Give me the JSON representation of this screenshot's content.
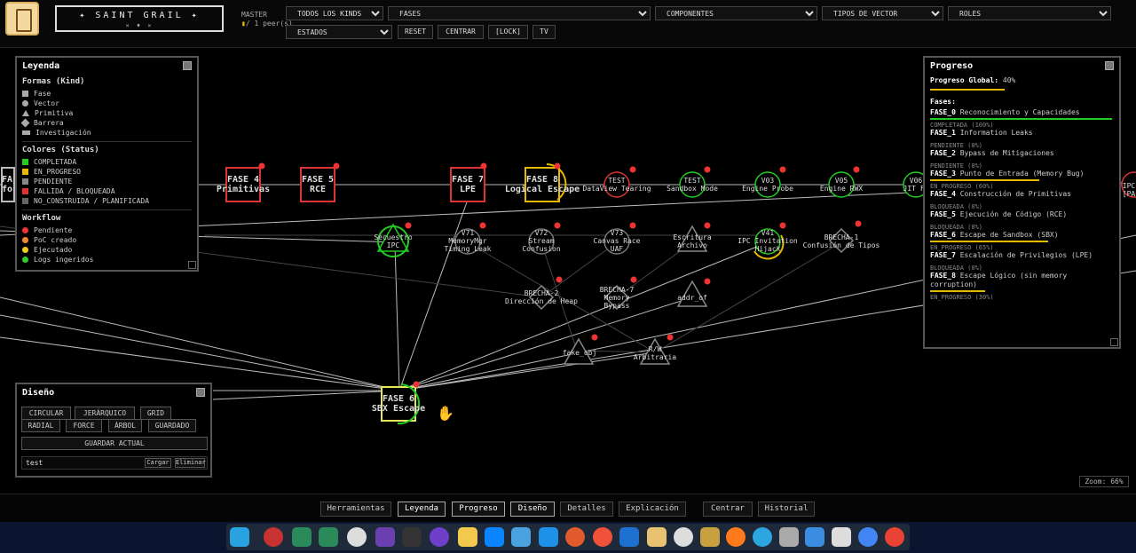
{
  "header": {
    "brand": "✦ SAINT GRAIL ✦",
    "brand_sub": "× ♦ ×",
    "mode_label": "MASTER",
    "peers": "/ 1 peer(s)",
    "filters": {
      "kinds": "TODOS LOS KINDS",
      "fases": "FASES",
      "componentes": "COMPONENTES",
      "tipos_vector": "TIPOS DE VECTOR",
      "roles": "ROLES",
      "estados": "ESTADOS"
    },
    "buttons": {
      "reset": "RESET",
      "centrar": "CENTRAR",
      "lock": "[LOCK]",
      "tv": "TV"
    }
  },
  "legend": {
    "title": "Leyenda",
    "shapes_title": "Formas (Kind)",
    "shapes": [
      "Fase",
      "Vector",
      "Primitiva",
      "Barrera",
      "Investigación"
    ],
    "status_title": "Colores (Status)",
    "status": [
      {
        "label": "COMPLETADA",
        "color": "#22cc22"
      },
      {
        "label": "EN_PROGRESO",
        "color": "#e6b800"
      },
      {
        "label": "PENDIENTE",
        "color": "#888888"
      },
      {
        "label": "FALLIDA / BLOQUEADA",
        "color": "#dd3333"
      },
      {
        "label": "NO_CONSTRUIDA / PLANIFICADA",
        "color": "#666666"
      }
    ],
    "workflow_title": "Workflow",
    "workflow": [
      {
        "label": "Pendiente",
        "color": "#ee3333"
      },
      {
        "label": "PoC creado",
        "color": "#ee8833"
      },
      {
        "label": "Ejecutado",
        "color": "#eecc22"
      },
      {
        "label": "Logs ingeridos",
        "color": "#33cc33"
      }
    ]
  },
  "graph": {
    "fases": [
      {
        "id": "f4",
        "l1": "FASE 4",
        "l2": "Primitivas"
      },
      {
        "id": "f5",
        "l1": "FASE 5",
        "l2": "RCE"
      },
      {
        "id": "f7",
        "l1": "FASE 7",
        "l2": "LPE"
      },
      {
        "id": "f8",
        "l1": "FASE 8",
        "l2": "Logical Escape"
      },
      {
        "id": "f6",
        "l1": "FASE 6",
        "l2": "SBX Escape"
      }
    ],
    "left_cut": [
      "FA",
      "fo"
    ],
    "right_cut": [
      "IPC",
      "[PA"
    ],
    "vectors": [
      {
        "l1": "TEST",
        "l2": "DataView Tearing"
      },
      {
        "l1": "TEST",
        "l2": "Sandbox Mode"
      },
      {
        "l1": "V03",
        "l2": "Engine Probe"
      },
      {
        "l1": "V05",
        "l2": "Engine RWX"
      },
      {
        "l1": "V06",
        "l2": "JIT Fu"
      },
      {
        "l1": "V71",
        "l2": "MemoryMgr Timing Leak"
      },
      {
        "l1": "V72",
        "l2": "Stream Confusion"
      },
      {
        "l1": "V73",
        "l2": "Canvas Race UAF"
      },
      {
        "l1": "V41",
        "l2": "IPC Invitation Hijack"
      }
    ],
    "others": [
      {
        "l1": "Secuestro",
        "l2": "IPC"
      },
      {
        "l1": "Escritura",
        "l2": "Archivo"
      },
      {
        "l1": "BRECHA-1",
        "l2": "Confusión de Tipos"
      },
      {
        "l1": "BRECHA-2",
        "l2": "Dirección de Heap"
      },
      {
        "l1": "BRECHA-7",
        "l2": "Memory Bypass"
      },
      {
        "l1": "addr_of",
        "l2": ""
      },
      {
        "l1": "fake_obj",
        "l2": ""
      },
      {
        "l1": "R/W",
        "l2": "Arbitraria"
      }
    ]
  },
  "progress": {
    "title": "Progreso",
    "global_label": "Progreso Global:",
    "global_value": "40%",
    "global_fraction": 0.4,
    "fases_title": "Fases:",
    "fases": [
      {
        "code": "FASE_0",
        "name": "Reconocimiento y Capacidades",
        "status": "COMPLETADA (100%)",
        "pct": 100,
        "color": "#22cc22"
      },
      {
        "code": "FASE_1",
        "name": "Information Leaks",
        "status": "PENDIENTE (0%)",
        "pct": 0,
        "color": "#888888"
      },
      {
        "code": "FASE_2",
        "name": "Bypass de Mitigaciones",
        "status": "PENDIENTE (0%)",
        "pct": 0,
        "color": "#888888"
      },
      {
        "code": "FASE_3",
        "name": "Punto de Entrada (Memory Bug)",
        "status": "EN_PROGRESO (60%)",
        "pct": 60,
        "color": "#e6b800"
      },
      {
        "code": "FASE_4",
        "name": "Construcción de Primitivas",
        "status": "BLOQUEADA (0%)",
        "pct": 0,
        "color": "#dd3333"
      },
      {
        "code": "FASE_5",
        "name": "Ejecución de Código (RCE)",
        "status": "BLOQUEADA (0%)",
        "pct": 0,
        "color": "#dd3333"
      },
      {
        "code": "FASE_6",
        "name": "Escape de Sandbox (SBX)",
        "status": "EN_PROGRESO (65%)",
        "pct": 65,
        "color": "#e6b800"
      },
      {
        "code": "FASE_7",
        "name": "Escalación de Privilegios (LPE)",
        "status": "BLOQUEADA (0%)",
        "pct": 0,
        "color": "#dd3333"
      },
      {
        "code": "FASE_8",
        "name": "Escape Lógico (sin memory corruption)",
        "status": "EN_PROGRESO (30%)",
        "pct": 30,
        "color": "#e6b800"
      }
    ]
  },
  "design": {
    "title": "Diseño",
    "layouts": [
      "CIRCULAR",
      "JERÁRQUICO",
      "GRID",
      "RADIAL",
      "FORCE",
      "ÁRBOL",
      "GUARDADO"
    ],
    "save": "GUARDAR ACTUAL",
    "saved_name": "test",
    "load": "Cargar",
    "delete": "Eliminar"
  },
  "zoom": "Zoom: 66%",
  "bottom_tabs": [
    "Herramientas",
    "Leyenda",
    "Progreso",
    "Diseño",
    "Detalles",
    "Explicación",
    "Centrar",
    "Historial"
  ]
}
